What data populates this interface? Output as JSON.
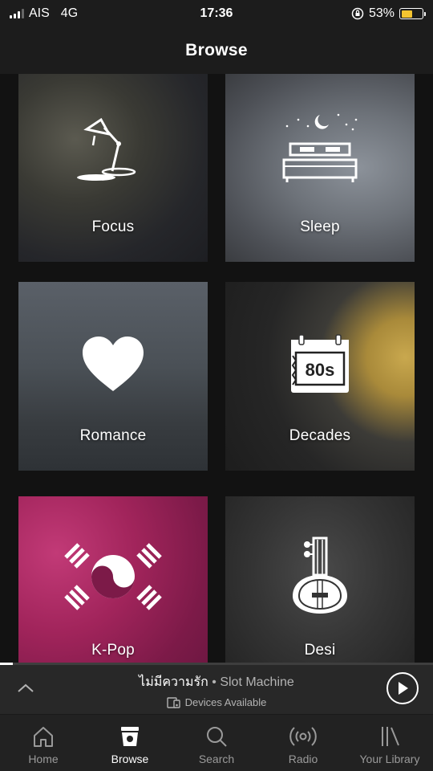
{
  "status_bar": {
    "carrier": "AIS",
    "network": "4G",
    "time": "17:36",
    "battery_percent": "53%",
    "battery_level": 0.53,
    "battery_color": "#f4c430"
  },
  "header": {
    "title": "Browse"
  },
  "categories": [
    {
      "label": "Focus",
      "icon": "desk-lamp-icon"
    },
    {
      "label": "Sleep",
      "icon": "bed-moon-icon"
    },
    {
      "label": "Romance",
      "icon": "heart-icon"
    },
    {
      "label": "Decades",
      "icon": "calendar-80s-icon",
      "icon_text": "80s"
    },
    {
      "label": "K-Pop",
      "icon": "korean-flag-icon"
    },
    {
      "label": "Desi",
      "icon": "sitar-icon"
    }
  ],
  "mini_player": {
    "track": "ไม่มีความรัก",
    "separator": " • ",
    "artist": "Slot Machine",
    "devices": "Devices Available",
    "progress": 0.03
  },
  "nav": {
    "items": [
      {
        "label": "Home",
        "icon": "home-icon",
        "active": false
      },
      {
        "label": "Browse",
        "icon": "browse-icon",
        "active": true
      },
      {
        "label": "Search",
        "icon": "search-icon",
        "active": false
      },
      {
        "label": "Radio",
        "icon": "radio-icon",
        "active": false
      },
      {
        "label": "Your Library",
        "icon": "library-icon",
        "active": false
      }
    ]
  }
}
